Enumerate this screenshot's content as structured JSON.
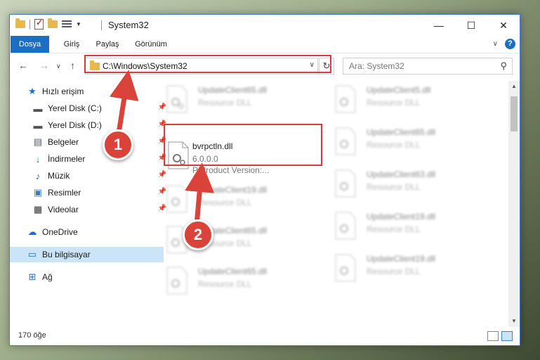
{
  "window": {
    "title": "System32",
    "controls": {
      "minimize": "—",
      "maximize": "☐",
      "close": "✕"
    }
  },
  "ribbon": {
    "tabs": [
      "Dosya",
      "Giriş",
      "Paylaş",
      "Görünüm"
    ],
    "help": "?"
  },
  "address": {
    "path": "C:\\Windows\\System32",
    "search_placeholder": "Ara: System32"
  },
  "nav_pane": {
    "quick_access": "Hızlı erişim",
    "items": [
      {
        "label": "Yerel Disk (C:)",
        "icon": "drive-icon",
        "pinned": true
      },
      {
        "label": "Yerel Disk (D:)",
        "icon": "drive-icon",
        "pinned": true
      },
      {
        "label": "Belgeler",
        "icon": "documents-icon",
        "pinned": true
      },
      {
        "label": "İndirmeler",
        "icon": "download-icon",
        "pinned": true
      },
      {
        "label": "Müzik",
        "icon": "music-icon",
        "pinned": true
      },
      {
        "label": "Resimler",
        "icon": "pictures-icon",
        "pinned": true
      },
      {
        "label": "Videolar",
        "icon": "videos-icon",
        "pinned": true
      }
    ],
    "onedrive": "OneDrive",
    "this_pc": "Bu bilgisayar",
    "network": "Ağ"
  },
  "files": {
    "left_column": [
      {
        "name": "UpdateClient65.dll",
        "desc": "Resource DLL",
        "blurred": true
      },
      {
        "name": "bvrpctln.dll",
        "version": "6.0.0.0",
        "desc": "P  Product Version:...",
        "blurred": false
      },
      {
        "name": "UpdateClient19.dll",
        "desc": "Resource DLL",
        "blurred": true
      },
      {
        "name": "UpdateClient65.dll",
        "desc": "Resource DLL",
        "blurred": true
      },
      {
        "name": "UpdateClient65.dll",
        "desc": "Resource DLL",
        "blurred": true
      }
    ],
    "right_column": [
      {
        "name": "UpdateClient5.dll",
        "desc": "Resource DLL",
        "blurred": true
      },
      {
        "name": "UpdateClient65.dll",
        "desc": "Resource DLL",
        "blurred": true
      },
      {
        "name": "UpdateClient63.dll",
        "desc": "Resource DLL",
        "blurred": true
      },
      {
        "name": "UpdateClient19.dll",
        "desc": "Resource DLL",
        "blurred": true
      },
      {
        "name": "UpdateClient19.dll",
        "desc": "Resource DLL",
        "blurred": true
      }
    ]
  },
  "status": {
    "count": "170 öğe"
  },
  "annotations": {
    "step1": "1",
    "step2": "2",
    "color": "#d9433a"
  }
}
